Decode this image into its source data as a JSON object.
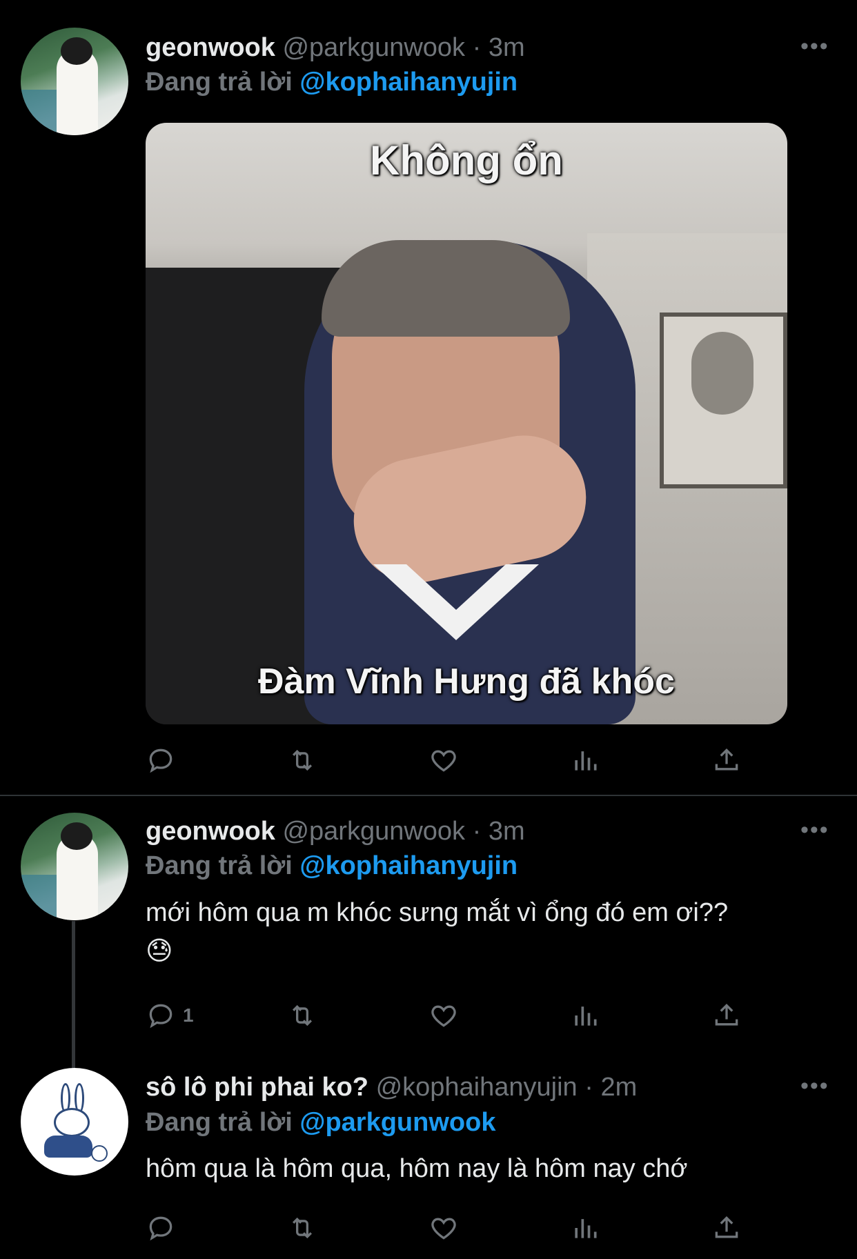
{
  "tweets": [
    {
      "name": "geonwook",
      "handle": "@parkgunwook",
      "dot": "·",
      "time": "3m",
      "replying_label": "Đang trả lời",
      "replying_to": "@kophaihanyujin",
      "more": "•••",
      "media": {
        "caption_top": "Không ổn",
        "caption_bottom": "Đàm Vĩnh Hưng đã khóc"
      },
      "reply_count": ""
    },
    {
      "name": "geonwook",
      "handle": "@parkgunwook",
      "dot": "·",
      "time": "3m",
      "replying_label": "Đang trả lời",
      "replying_to": "@kophaihanyujin",
      "more": "•••",
      "text": "mới hôm qua m khóc sưng mắt vì ổng đó em ơi??",
      "emoji": "😓",
      "reply_count": "1"
    },
    {
      "name": "sô lô phi phai ko?",
      "handle": "@kophaihanyujin",
      "dot": "·",
      "time": "2m",
      "replying_label": "Đang trả lời",
      "replying_to": "@parkgunwook",
      "more": "•••",
      "text": "hôm qua là hôm qua, hôm nay là hôm nay chớ",
      "reply_count": ""
    }
  ],
  "icons": {
    "reply": "reply-icon",
    "retweet": "retweet-icon",
    "like": "heart-icon",
    "views": "analytics-icon",
    "share": "share-icon"
  },
  "colors": {
    "background": "#000000",
    "text": "#e7e9ea",
    "muted": "#71767b",
    "accent": "#1d9bf0"
  }
}
